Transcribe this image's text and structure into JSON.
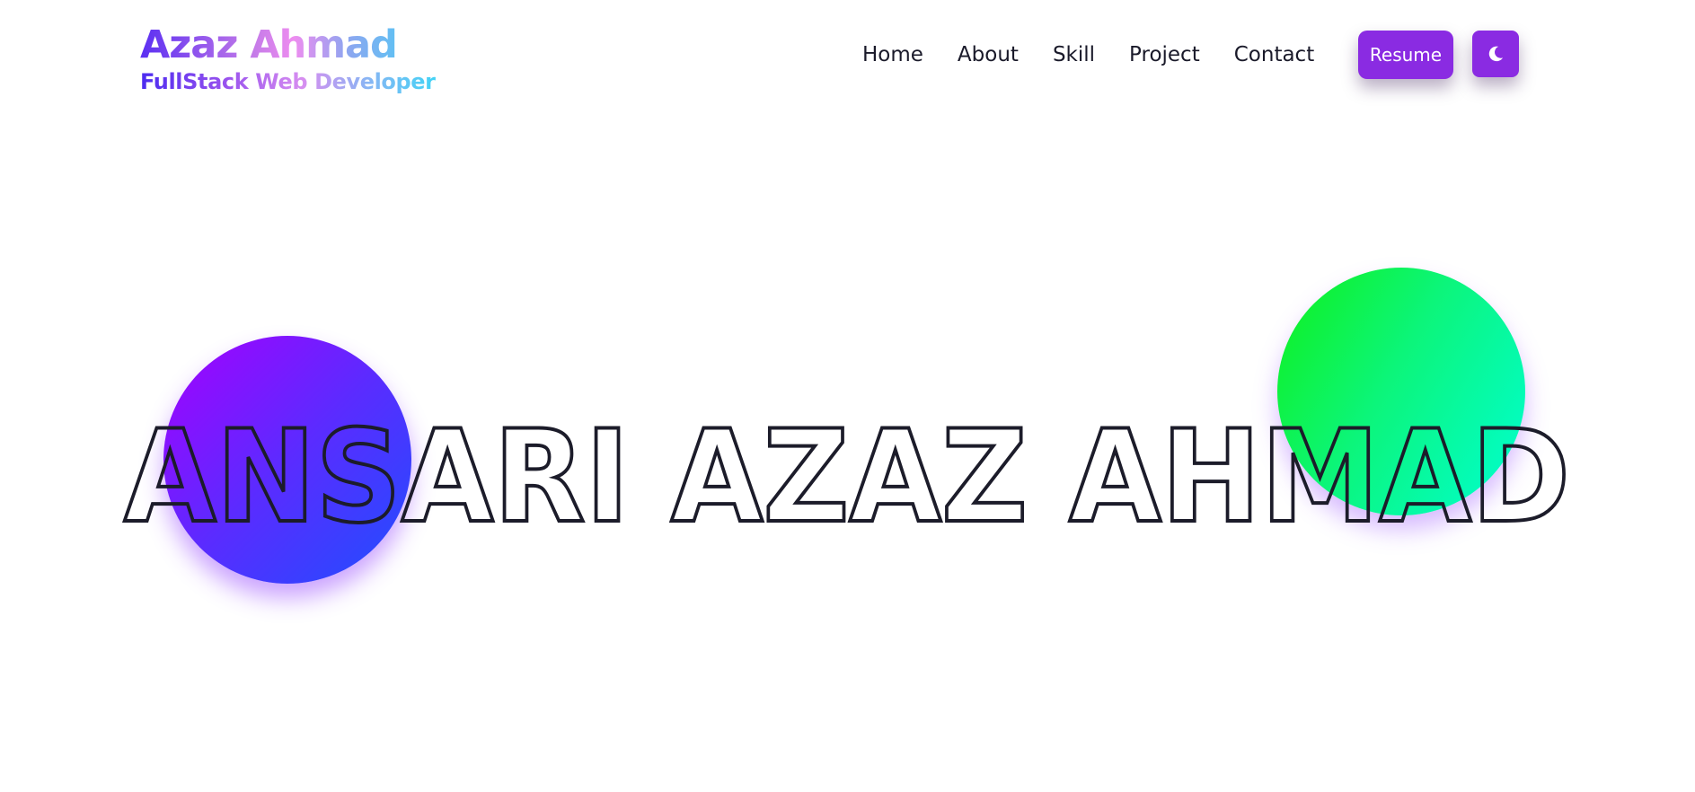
{
  "brand": {
    "name": "Azaz Ahmad",
    "role": "FullStack Web Developer"
  },
  "nav": {
    "items": [
      "Home",
      "About",
      "Skill",
      "Project",
      "Contact"
    ],
    "resume_label": "Resume",
    "theme_toggle_icon": "moon-icon"
  },
  "hero": {
    "title": "ANSARI AZAZ AHMAD"
  },
  "colors": {
    "accent": "#8a2be2",
    "text": "#1a1a2a",
    "blob_purple_start": "#a500ff",
    "blob_purple_end": "#1f4fff",
    "blob_green_start": "#10f01a",
    "blob_green_end": "#00ffd4"
  }
}
